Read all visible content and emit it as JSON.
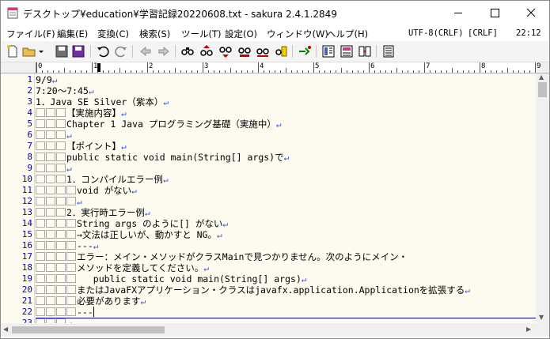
{
  "window": {
    "title": "デスクトップ¥education¥学習記録20220608.txt - sakura 2.4.1.2849"
  },
  "window_controls": {
    "minimize_icon": "minimize-icon",
    "maximize_icon": "maximize-icon",
    "close_icon": "close-icon"
  },
  "menu": {
    "items": [
      {
        "label": "ファイル(F)"
      },
      {
        "label": "編集(E)"
      },
      {
        "label": "変換(C)"
      },
      {
        "label": "検索(S)"
      },
      {
        "label": "ツール(T)"
      },
      {
        "label": "設定(O)"
      },
      {
        "label": "ウィンドウ(W)"
      },
      {
        "label": "ヘルプ(H)"
      }
    ],
    "encoding": "UTF-8(CRLF)",
    "eol": "[CRLF]",
    "time": "22:12"
  },
  "toolbar": {
    "icons": [
      "new-file-icon",
      "open-folder-icon",
      "dropdown-icon",
      "save-icon",
      "save-all-icon",
      "undo-icon",
      "redo-icon",
      "jump-back-icon",
      "jump-forward-icon",
      "search-icon",
      "search-prev-icon",
      "search-next-icon",
      "replace-icon",
      "select-icon",
      "bookmark-icon",
      "grep-icon",
      "outline-icon",
      "tag-jump-icon",
      "compare-icon",
      "settings-icon"
    ]
  },
  "ruler": {
    "labels": [
      "0",
      "1",
      "2",
      "3",
      "4",
      "5",
      "6",
      "7",
      "8",
      "9"
    ]
  },
  "lines": [
    {
      "n": "1",
      "indent": 0,
      "text": "9/9",
      "ret": "↵"
    },
    {
      "n": "2",
      "indent": 0,
      "text": "7:20～7:45",
      "ret": "↵"
    },
    {
      "n": "3",
      "indent": 0,
      "text": "1．Java SE Silver（紫本）",
      "ret": "↵"
    },
    {
      "n": "4",
      "indent": 3,
      "text": "【実施内容】",
      "ret": "↵"
    },
    {
      "n": "5",
      "indent": 3,
      "text": "Chapter 1 Java プログラミング基礎（実施中）",
      "ret": "↵"
    },
    {
      "n": "6",
      "indent": 3,
      "text": "",
      "ret": "↵"
    },
    {
      "n": "7",
      "indent": 3,
      "text": "【ポイント】",
      "ret": "↵"
    },
    {
      "n": "8",
      "indent": 3,
      "text": "public static void main(String[] args)で",
      "ret": "↵"
    },
    {
      "n": "9",
      "indent": 3,
      "text": "",
      "ret": "↵"
    },
    {
      "n": "10",
      "indent": 3,
      "text": "1．コンパイルエラー例",
      "ret": "↵"
    },
    {
      "n": "11",
      "indent": 4,
      "text": "void がない",
      "ret": "↵"
    },
    {
      "n": "12",
      "indent": 4,
      "text": "",
      "ret": "↵"
    },
    {
      "n": "13",
      "indent": 3,
      "text": "2．実行時エラー例",
      "ret": "↵"
    },
    {
      "n": "14",
      "indent": 4,
      "text": "String args のように[] がない",
      "ret": "↵"
    },
    {
      "n": "15",
      "indent": 4,
      "text": "→文法は正しいが、動かすと NG。",
      "ret": "↵"
    },
    {
      "n": "16",
      "indent": 4,
      "text": "---",
      "ret": "↵"
    },
    {
      "n": "17",
      "indent": 4,
      "text": "エラー：メイン・メソッドがクラスMainで見つかりません。次のようにメイン・",
      "ret": ""
    },
    {
      "n": "18",
      "indent": 4,
      "text": "メソッドを定義してください。",
      "ret": "↵"
    },
    {
      "n": "19",
      "indent": 4,
      "text": "   public static void main(String[] args)",
      "ret": "↵"
    },
    {
      "n": "20",
      "indent": 4,
      "text": "またはJavaFXアプリケーション・クラスはjavafx.application.Applicationを拡張する",
      "ret": "↵"
    },
    {
      "n": "21",
      "indent": 4,
      "text": "必要があります",
      "ret": "↵"
    },
    {
      "n": "22",
      "indent": 4,
      "text": "---",
      "ret": "",
      "caret": true
    },
    {
      "n": "23",
      "indent": 3,
      "text": "",
      "ret": "↵"
    }
  ],
  "colors": {
    "editor_bg": "#fdfbef",
    "line_number": "#0000c0",
    "return_mark": "#3050e0"
  }
}
